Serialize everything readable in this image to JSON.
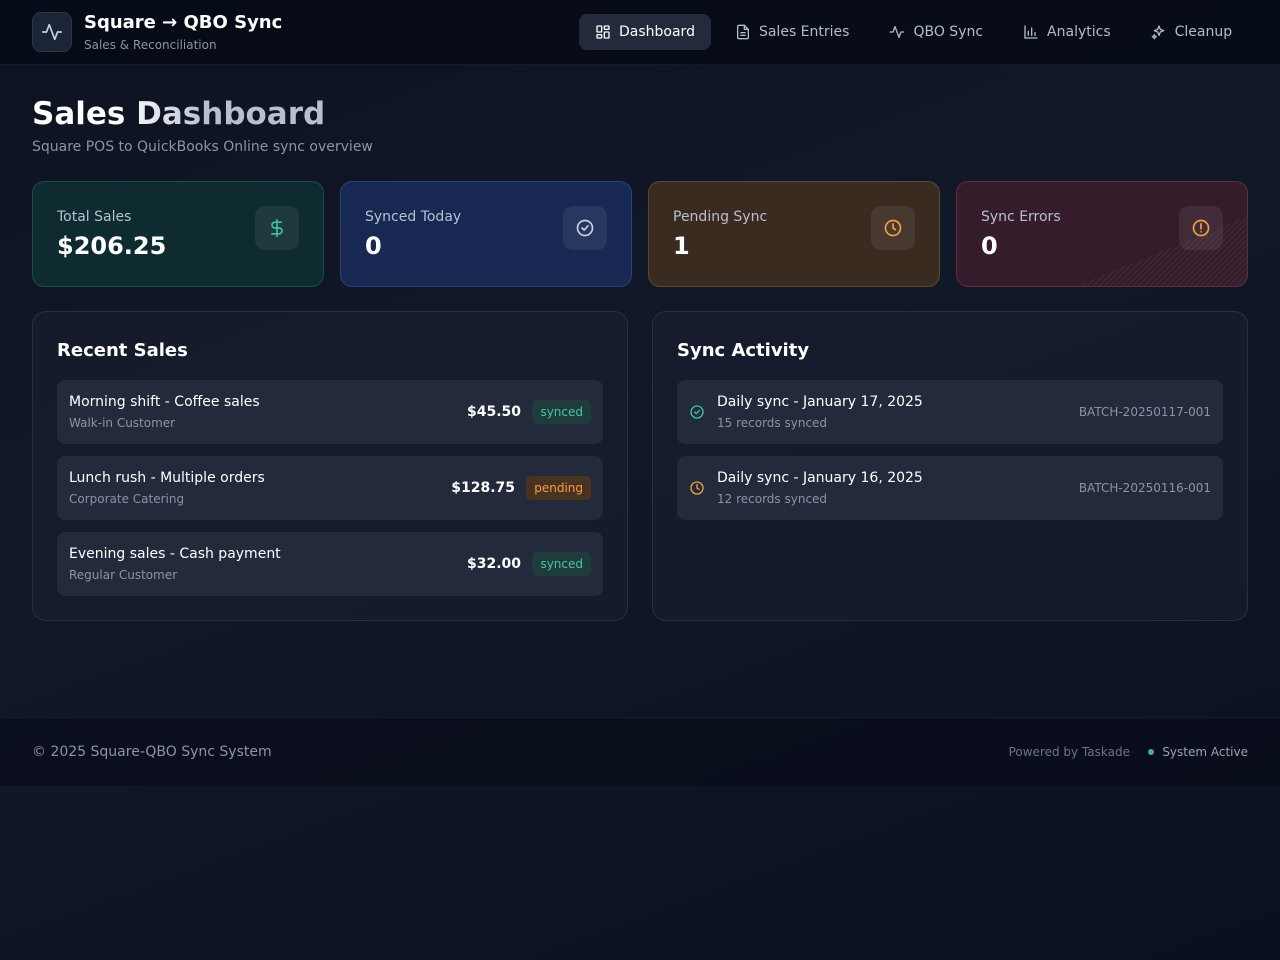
{
  "header": {
    "title": "Square → QBO Sync",
    "subtitle": "Sales & Reconciliation",
    "logo_icon": "activity-icon",
    "nav": [
      {
        "label": "Dashboard",
        "icon": "grid-icon",
        "active": true
      },
      {
        "label": "Sales Entries",
        "icon": "file-text-icon",
        "active": false
      },
      {
        "label": "QBO Sync",
        "icon": "activity-icon",
        "active": false
      },
      {
        "label": "Analytics",
        "icon": "bar-chart-icon",
        "active": false
      },
      {
        "label": "Cleanup",
        "icon": "sparkles-icon",
        "active": false
      }
    ]
  },
  "page": {
    "title": "Sales Dashboard",
    "subtitle": "Square POS to QuickBooks Online sync overview"
  },
  "stats": [
    {
      "label": "Total Sales",
      "value": "$206.25",
      "icon": "dollar-icon",
      "color": "#3fc59a"
    },
    {
      "label": "Synced Today",
      "value": "0",
      "icon": "check-circle-icon",
      "color": "#c9d2e6"
    },
    {
      "label": "Pending Sync",
      "value": "1",
      "icon": "clock-icon",
      "color": "#f2a040"
    },
    {
      "label": "Sync Errors",
      "value": "0",
      "icon": "alert-circle-icon",
      "color": "#f2a040"
    }
  ],
  "recent_sales": {
    "title": "Recent Sales",
    "items": [
      {
        "title": "Morning shift - Coffee sales",
        "customer": "Walk-in Customer",
        "amount": "$45.50",
        "status": "synced"
      },
      {
        "title": "Lunch rush - Multiple orders",
        "customer": "Corporate Catering",
        "amount": "$128.75",
        "status": "pending"
      },
      {
        "title": "Evening sales - Cash payment",
        "customer": "Regular Customer",
        "amount": "$32.00",
        "status": "synced"
      }
    ]
  },
  "sync_activity": {
    "title": "Sync Activity",
    "items": [
      {
        "title": "Daily sync - January 17, 2025",
        "records": "15 records synced",
        "batch": "BATCH-20250117-001",
        "icon": "check-circle-icon",
        "color": "#3fc59a"
      },
      {
        "title": "Daily sync - January 16, 2025",
        "records": "12 records synced",
        "batch": "BATCH-20250116-001",
        "icon": "clock-icon",
        "color": "#f2a040"
      }
    ]
  },
  "footer": {
    "copyright": "© 2025 Square-QBO Sync System",
    "powered": "Powered by Taskade",
    "status": "System Active"
  }
}
